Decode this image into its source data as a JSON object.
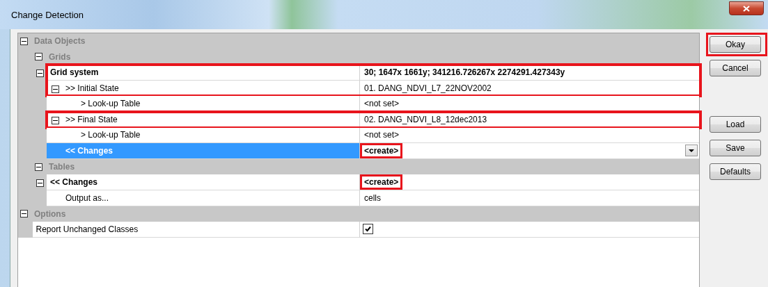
{
  "window": {
    "title": "Change Detection"
  },
  "properties": [
    {
      "kind": "category",
      "label": "Data Objects",
      "expanded": true,
      "children": [
        {
          "kind": "category",
          "label": "Grids",
          "expanded": true,
          "children": [
            {
              "kind": "property",
              "label": "Grid system",
              "value": "30; 1647x 1661y; 341216.726267x 2274291.427343y",
              "bold": true,
              "expanded": true,
              "selected": false,
              "highlighted": true,
              "value_highlighted": false,
              "children": [
                {
                  "kind": "property",
                  "label": ">> Initial State",
                  "value": "01. DANG_NDVI_L7_22NOV2002",
                  "bold": false,
                  "expanded": true,
                  "selected": false,
                  "highlighted": true,
                  "value_highlighted": false,
                  "children": [
                    {
                      "kind": "property",
                      "label": "> Look-up Table",
                      "value": "<not set>",
                      "bold": false,
                      "selected": false,
                      "highlighted": false,
                      "value_highlighted": false
                    }
                  ]
                },
                {
                  "kind": "property",
                  "label": ">> Final State",
                  "value": "02. DANG_NDVI_L8_12dec2013",
                  "bold": false,
                  "expanded": true,
                  "selected": false,
                  "highlighted": true,
                  "value_highlighted": false,
                  "children": [
                    {
                      "kind": "property",
                      "label": "> Look-up Table",
                      "value": "<not set>",
                      "bold": false,
                      "selected": false,
                      "highlighted": false,
                      "value_highlighted": false
                    }
                  ]
                },
                {
                  "kind": "property",
                  "label": "<< Changes",
                  "value": "<create>",
                  "bold": true,
                  "selected": true,
                  "highlighted": false,
                  "value_highlighted": true
                }
              ]
            }
          ]
        },
        {
          "kind": "category",
          "label": "Tables",
          "expanded": true,
          "children": [
            {
              "kind": "property",
              "label": "<< Changes",
              "value": "<create>",
              "bold": true,
              "expanded": true,
              "selected": false,
              "highlighted": false,
              "value_highlighted": true,
              "children": [
                {
                  "kind": "property",
                  "label": "Output as...",
                  "value": "cells",
                  "bold": false,
                  "selected": false,
                  "highlighted": false,
                  "value_highlighted": false
                }
              ]
            }
          ]
        }
      ]
    },
    {
      "kind": "category",
      "label": "Options",
      "expanded": true,
      "children": [
        {
          "kind": "property",
          "label": "Report Unchanged Classes",
          "checked": true,
          "bold": false,
          "selected": false,
          "highlighted": false
        }
      ]
    }
  ],
  "buttons_top": [
    {
      "label": "Okay",
      "highlighted": true
    },
    {
      "label": "Cancel",
      "highlighted": false
    }
  ],
  "buttons_bottom": [
    {
      "label": "Load",
      "highlighted": false
    },
    {
      "label": "Save",
      "highlighted": false
    },
    {
      "label": "Defaults",
      "highlighted": false
    }
  ]
}
